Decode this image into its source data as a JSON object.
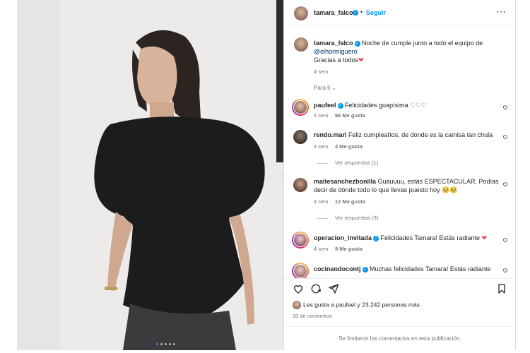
{
  "header": {
    "username": "tamara_falco",
    "follow_label": "Seguir",
    "more_icon": "ellipsis-icon"
  },
  "caption": {
    "username": "tamara_falco",
    "text_part1": "Noche de cumple junto a todo el equipo de",
    "mention": "@elhormiguero",
    "text_part2": "Gracias a todos",
    "emoji": "❤",
    "time": "4 sem"
  },
  "filter": {
    "label": "Para ti"
  },
  "comments": [
    {
      "username": "paufeel",
      "verified": true,
      "text": "Felicidades guapísima ♡♡♡",
      "time": "4 sem",
      "likes": "66 Me gusta"
    },
    {
      "username": "rendo.mari",
      "verified": false,
      "text": "Feliz cumpleaños, de donde es la camisa tan chula",
      "time": "4 sem",
      "likes": "4 Me gusta",
      "replies": "Ver respuestas (1)"
    },
    {
      "username": "maitesanchezbonilla",
      "verified": false,
      "text_line1": "Guauuuu, estás ESPECTACULAR. Podías",
      "text_line2": "decir de dónde todo lo que llevas puesto hoy 🥺🥺",
      "time": "4 sem",
      "likes": "12 Me gusta",
      "replies": "Ver respuestas (3)"
    },
    {
      "username": "operacion_invitada",
      "verified": true,
      "text": "Felicidades Tamara! Estás radiante",
      "emoji": "❤",
      "time": "4 sem",
      "likes": "9 Me gusta"
    },
    {
      "username": "cocinandocontj",
      "verified": true,
      "text": "Muchas felicidades Tamara! Estás radiante"
    }
  ],
  "likes_summary": "Les gusta a paufeel y 23.242 personas más",
  "date": "20 de noviembre",
  "comments_limited": "Se limitaron los comentarios en esta publicación.",
  "carousel": {
    "total": 5,
    "current": 1
  },
  "colors": {
    "verified": "#0095f6",
    "follow": "#0095f6",
    "heart": "#ed4956",
    "border": "#dbdbdb"
  }
}
